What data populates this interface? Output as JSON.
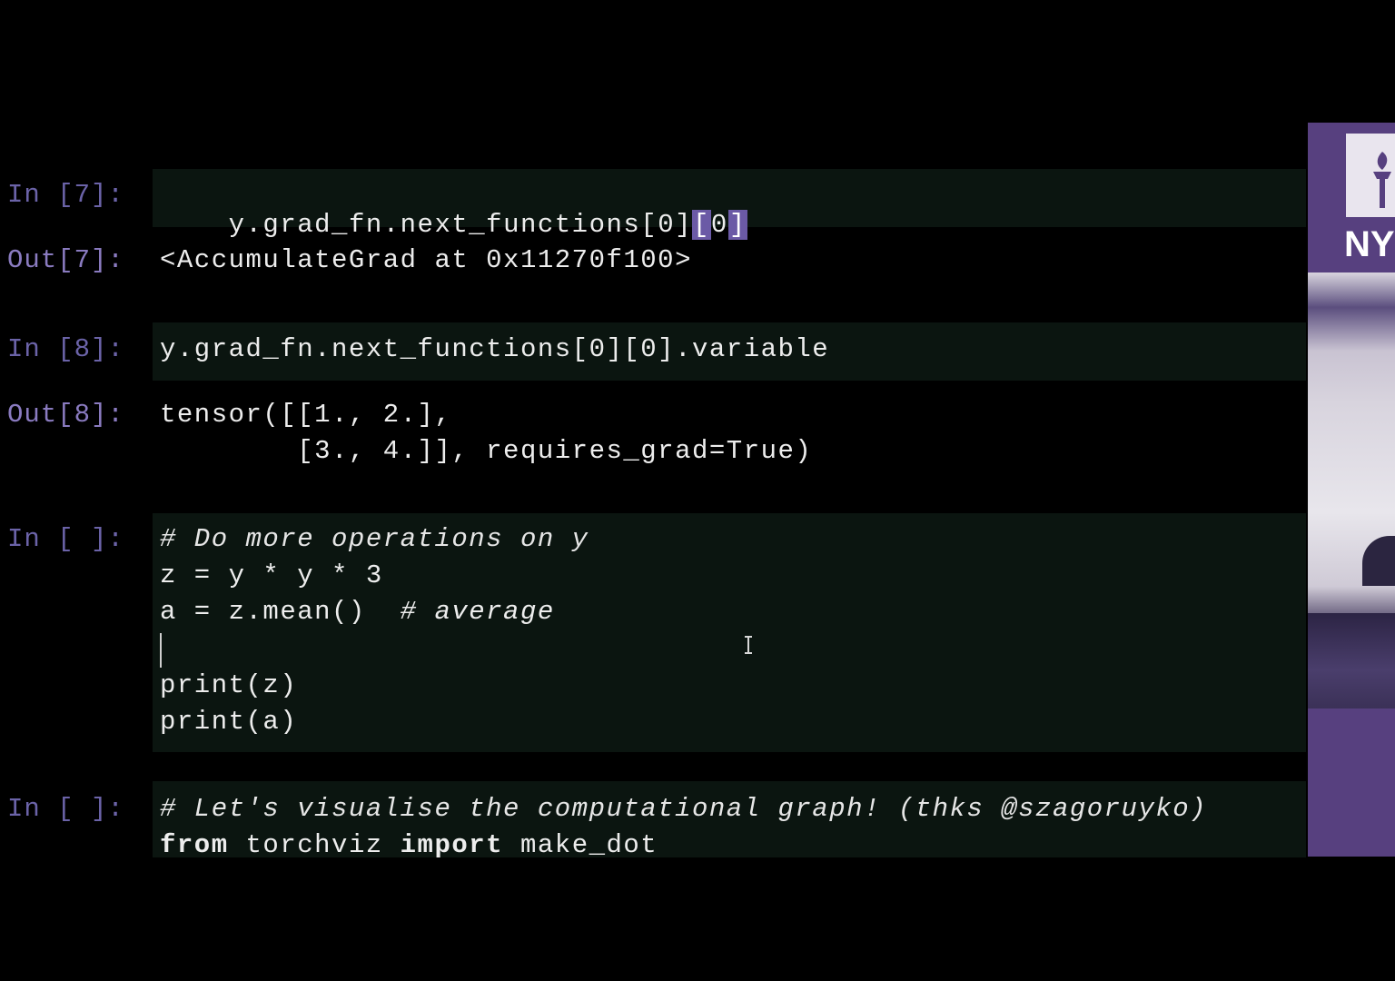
{
  "notebook": {
    "cells": [
      {
        "in_prompt": "In [7]:",
        "code": {
          "before": "y.grad_fn.next_functions[0]",
          "highlight_open": "[",
          "highlight_mid": "0",
          "highlight_close": "]"
        },
        "out_prompt": "Out[7]:",
        "output": [
          "<AccumulateGrad at 0x11270f100>"
        ]
      },
      {
        "in_prompt": "In [8]:",
        "code": [
          "y.grad_fn.next_functions[0][0].variable"
        ],
        "out_prompt": "Out[8]:",
        "output": [
          "tensor([[1., 2.],",
          "        [3., 4.]], requires_grad=True)"
        ]
      },
      {
        "in_prompt": "In [ ]:",
        "code": [
          "# Do more operations on y",
          "z = y * y * 3",
          "a = z.mean()  ",
          "# average",
          "",
          "print(z)",
          "print(a)"
        ]
      },
      {
        "in_prompt": "In [ ]:",
        "code": [
          "# Let's visualise the computational graph! (thks @szagoruyko)",
          "from",
          " torchviz ",
          "import",
          " make_dot"
        ]
      }
    ]
  },
  "side_video": {
    "logo_text": "NY",
    "brand_color": "#57407f"
  },
  "colors": {
    "background": "#000000",
    "cell_background": "#0b1510",
    "prompt": "#6b63a8",
    "bracket_highlight": "#6b5aa6"
  }
}
